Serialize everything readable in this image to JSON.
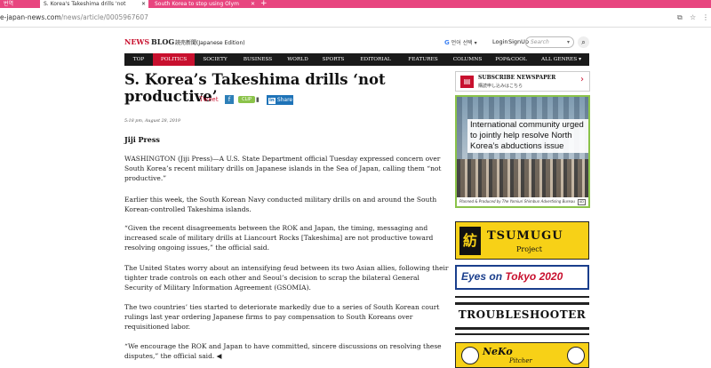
{
  "browser": {
    "tabs": [
      {
        "label": "번역",
        "active": false
      },
      {
        "label": "S. Korea's Takeshima drills 'not",
        "active": true
      },
      {
        "label": "South Korea to stop using Olym",
        "active": false
      }
    ],
    "new_tab": "+",
    "url_host": "e-japan-news.com",
    "url_path": "/news/article/0005967607"
  },
  "site": {
    "logo_news": "NEWS",
    "logo_blog": "BLOG",
    "logo_edition": "読売新聞(Japanese Edition)",
    "lang_g": "G",
    "lang_label": "언어 선택",
    "login": "Login",
    "signup": "SignUp",
    "search_placeholder": "Search",
    "search_drop": "▾",
    "search_icon": "🔍"
  },
  "nav": [
    "TOP",
    "POLITICS",
    "SOCIETY",
    "BUSINESS",
    "WORLD",
    "SPORTS",
    "EDITORIAL",
    "FEATURES",
    "COLUMNS",
    "POP&COOL",
    "ALL GENRES ▾"
  ],
  "article": {
    "title": "S. Korea’s Takeshima drills ‘not productive’",
    "share": {
      "tweet": "Tweet",
      "fb": "f",
      "clip": "CLIP",
      "bookmark": "▮",
      "linkedin_in": "in",
      "linkedin_label": "Share"
    },
    "date": "5:18 pm, August 28, 2019",
    "byline": "Jiji Press",
    "paragraphs": [
      "WASHINGTON (Jiji Press)—A U.S. State Department official Tuesday expressed concern over South Korea’s recent military drills on Japanese islands in the Sea of Japan, calling them “not productive.”",
      "Earlier this week, the South Korean Navy conducted military drills on and around the South Korean-controlled Takeshima islands.",
      "“Given the recent disagreements between the ROK and Japan, the timing, messaging and increased scale of military drills at Liancourt Rocks [Takeshima] are not productive toward resolving ongoing issues,” the official said.",
      "The United States worry about an intensifying feud between its two Asian allies, following their tighter trade controls on each other and Seoul’s decision to scrap the bilateral General Security of Military Information Agreement (GSOMIA).",
      "The two countries’ ties started to deteriorate markedly due to a series of South Korean court rulings last year ordering Japanese firms to pay compensation to South Koreans over requisitioned labor.",
      "“We encourage the ROK and Japan to have committed, sincere discussions on resolving these disputes,” the official said. ◀"
    ]
  },
  "sidebar": {
    "subscribe_title": "SUBSCRIBE NEWSPAPER",
    "subscribe_jp": "購読申し込みはこちら",
    "subscribe_chev": "›",
    "ad1_text": "International community urged to jointly help resolve North Korea’s abductions issue",
    "ad1_foot": "Planned & Produced by The Yomiuri Shimbun Advertising Bureau",
    "ad1_badge": "AD",
    "tsumugu_logo": "紡",
    "tsumugu_title": "TSUMUGU",
    "tsumugu_sub": "Project",
    "eyes_a": "Eyes on ",
    "eyes_b": "Tokyo 2020",
    "trouble": "TROUBLESHOOTER",
    "neko_title": "NeKo",
    "neko_sub": "Pitcher"
  }
}
